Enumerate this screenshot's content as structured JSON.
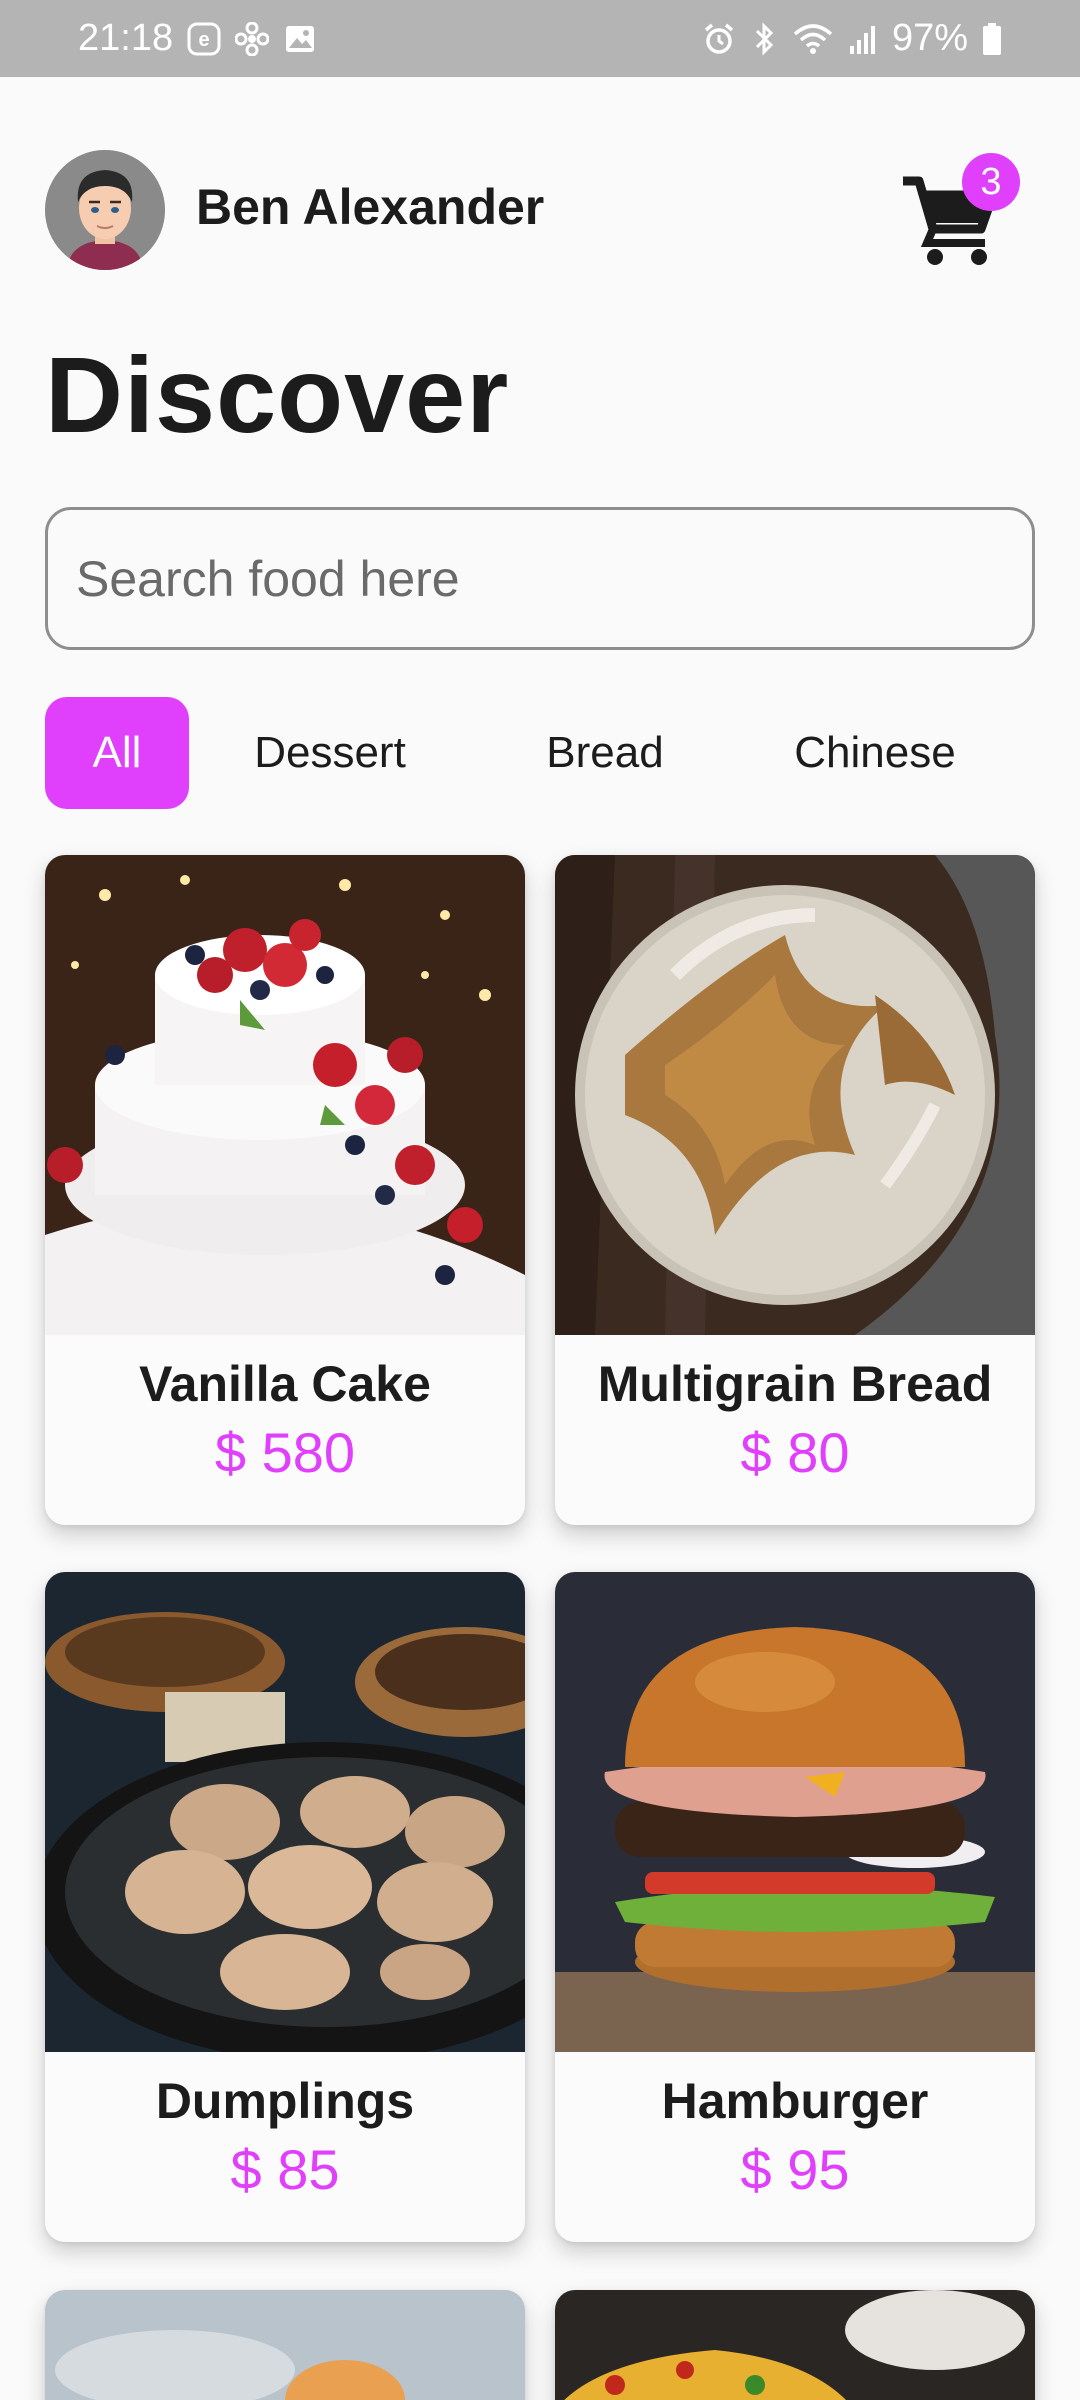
{
  "status_bar": {
    "time": "21:18",
    "battery": "97%"
  },
  "header": {
    "user_name": "Ben Alexander",
    "cart_count": "3"
  },
  "page_title": "Discover",
  "search": {
    "placeholder": "Search food here",
    "value": ""
  },
  "categories": [
    {
      "label": "All",
      "selected": true
    },
    {
      "label": "Dessert",
      "selected": false
    },
    {
      "label": "Bread",
      "selected": false
    },
    {
      "label": "Chinese",
      "selected": false
    }
  ],
  "foods": [
    {
      "name": "Vanilla Cake",
      "price": "$ 580"
    },
    {
      "name": "Multigrain Bread",
      "price": "$ 80"
    },
    {
      "name": "Dumplings",
      "price": "$ 85"
    },
    {
      "name": "Hamburger",
      "price": "$ 95"
    }
  ],
  "colors": {
    "accent": "#e040fb",
    "status_bar": "#b4b4b4",
    "background": "#fafafa"
  }
}
